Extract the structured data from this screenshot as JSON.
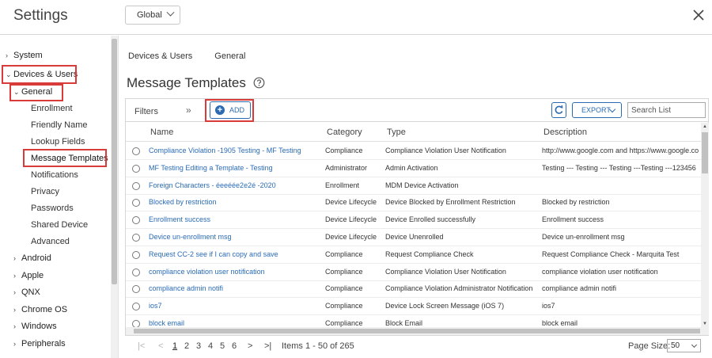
{
  "header": {
    "title": "Settings",
    "scope": "Global"
  },
  "sidebar": {
    "items": [
      {
        "label": "System",
        "expanded": false
      },
      {
        "label": "Devices & Users",
        "expanded": true
      },
      {
        "label": "General",
        "expanded": true
      },
      {
        "label": "Android",
        "expanded": false
      },
      {
        "label": "Apple",
        "expanded": false
      },
      {
        "label": "QNX",
        "expanded": false
      },
      {
        "label": "Chrome OS",
        "expanded": false
      },
      {
        "label": "Windows",
        "expanded": false
      },
      {
        "label": "Peripherals",
        "expanded": false
      }
    ],
    "general_children": [
      "Enrollment",
      "Friendly Name",
      "Lookup Fields",
      "Message Templates",
      "Notifications",
      "Privacy",
      "Passwords",
      "Shared Device",
      "Advanced"
    ],
    "selected": "Message Templates"
  },
  "breadcrumb": [
    "Devices & Users",
    "General"
  ],
  "page_title": "Message Templates",
  "toolbar": {
    "filters_label": "Filters",
    "add_label": "ADD",
    "export_label": "EXPORT",
    "search_placeholder": "Search List"
  },
  "table": {
    "columns": [
      "Name",
      "Category",
      "Type",
      "Description"
    ],
    "rows": [
      {
        "name": "Compliance Violation -1905 Testing - MF Testing",
        "category": "Compliance",
        "type": "Compliance Violation User Notification",
        "description": "http://www.google.com and https://www.google.co"
      },
      {
        "name": "MF Testing Editing a Template - Testing",
        "category": "Administrator",
        "type": "Admin Activation",
        "description": "Testing --- Testing --- Testing ---Testing ---123456"
      },
      {
        "name": "Foreign Characters - éeeéée2e2é -2020",
        "category": "Enrollment",
        "type": "MDM Device Activation",
        "description": ""
      },
      {
        "name": "Blocked by restriction",
        "category": "Device Lifecycle",
        "type": "Device Blocked by Enrollment Restriction",
        "description": "Blocked by restriction"
      },
      {
        "name": "Enrollment success",
        "category": "Device Lifecycle",
        "type": "Device Enrolled successfully",
        "description": "Enrollment success"
      },
      {
        "name": "Device un-enrollment msg",
        "category": "Device Lifecycle",
        "type": "Device Unenrolled",
        "description": "Device un-enrollment msg"
      },
      {
        "name": "Request CC-2 see if I can copy and save",
        "category": "Compliance",
        "type": "Request Compliance Check",
        "description": "Request Compliance Check - Marquita Test"
      },
      {
        "name": "compliance violation user notification",
        "category": "Compliance",
        "type": "Compliance Violation User Notification",
        "description": "compliance violation user notification"
      },
      {
        "name": "compliance admin notifi",
        "category": "Compliance",
        "type": "Compliance Violation Administrator Notification",
        "description": "compliance admin notifi"
      },
      {
        "name": "ios7",
        "category": "Compliance",
        "type": "Device Lock Screen Message (iOS 7)",
        "description": "ios7"
      },
      {
        "name": "block email",
        "category": "Compliance",
        "type": "Block Email",
        "description": "block email"
      }
    ]
  },
  "pager": {
    "first": "|<",
    "prev": "<",
    "pages": [
      "1",
      "2",
      "3",
      "4",
      "5",
      "6"
    ],
    "current_page": "1",
    "next": ">",
    "last": ">|",
    "items_label": "Items 1 - 50 of 265",
    "page_size_label": "Page Size:",
    "page_size": "50"
  },
  "colors": {
    "link": "#2a6bb5",
    "accent": "#2b6cb0",
    "highlight_box": "#d93a3a"
  },
  "icons": [
    "close-icon",
    "help-icon",
    "plus-icon",
    "refresh-icon",
    "chevron-down-icon",
    "caret-right-icon",
    "caret-down-icon"
  ]
}
